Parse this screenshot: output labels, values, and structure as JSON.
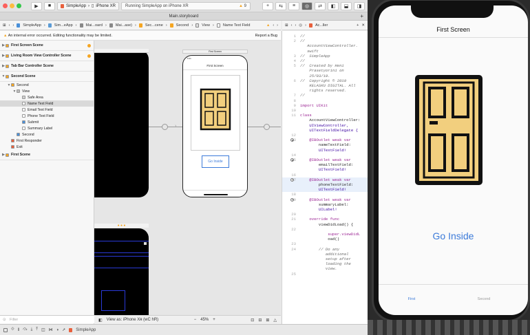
{
  "toolbar": {
    "scheme_app": "SimpleApp",
    "device": "iPhone XR",
    "status": "Running SimpleApp on iPhone XR",
    "warnings": "9"
  },
  "tabbar": {
    "title": "Main.storyboard"
  },
  "jumpbar": {
    "items": [
      "SimpleApp",
      "Sim...eApp",
      "Mai...oard",
      "Mai...ase)",
      "Sec...cene",
      "Second",
      "View",
      "Name Text Field"
    ]
  },
  "jumpbar2": {
    "file": "Ac...ller"
  },
  "errorbar": {
    "message": "An internal error occurred. Editing functionality may be limited.",
    "action": "Report a Bug"
  },
  "outline": {
    "rows": [
      {
        "label": "First Screen Scene",
        "level": 0,
        "tri": "▶",
        "icon": "scene-icon",
        "color": "#f5a623",
        "header": true,
        "warn": true
      },
      {
        "label": "Living Room View Controller Scene",
        "level": 0,
        "tri": "▶",
        "icon": "scene-icon",
        "color": "#f5a623",
        "header": true,
        "warn": true
      },
      {
        "label": "Tab Bar Controller Scene",
        "level": 0,
        "tri": "▶",
        "icon": "scene-icon",
        "color": "#f5a623",
        "header": true,
        "warn": false
      },
      {
        "label": "Second Scene",
        "level": 0,
        "tri": "▼",
        "icon": "scene-icon",
        "color": "#f5a623",
        "header": true,
        "warn": false
      },
      {
        "label": "Second",
        "level": 1,
        "tri": "▼",
        "icon": "view-controller-icon",
        "color": "#f5a623"
      },
      {
        "label": "View",
        "level": 2,
        "tri": "▼",
        "icon": "view-icon",
        "color": "#bbbbbb"
      },
      {
        "label": "Safe Area",
        "level": 3,
        "tri": "",
        "icon": "safe-area-icon",
        "color": "#cfcfcf"
      },
      {
        "label": "Name Text Field",
        "level": 3,
        "tri": "",
        "icon": "textfield-icon",
        "color": "#ffffff",
        "sel": true
      },
      {
        "label": "Email Text Field",
        "level": 3,
        "tri": "",
        "icon": "textfield-icon",
        "color": "#ffffff"
      },
      {
        "label": "Phone Text Field",
        "level": 3,
        "tri": "",
        "icon": "textfield-icon",
        "color": "#ffffff"
      },
      {
        "label": "Submit",
        "level": 3,
        "tri": "",
        "icon": "button-icon",
        "color": "#4a90d9"
      },
      {
        "label": "Summary Label",
        "level": 3,
        "tri": "",
        "icon": "label-icon",
        "color": "#ffffff"
      },
      {
        "label": "Second",
        "level": 2,
        "tri": "",
        "icon": "tabbar-item-icon",
        "color": "#4a90d9"
      },
      {
        "label": "First Responder",
        "level": 1,
        "tri": "",
        "icon": "first-responder-icon",
        "color": "#e8603c"
      },
      {
        "label": "Exit",
        "level": 1,
        "tri": "",
        "icon": "exit-icon",
        "color": "#e8603c"
      },
      {
        "label": "First Scene",
        "level": 0,
        "tri": "▶",
        "icon": "scene-icon",
        "color": "#f5a623",
        "header": true,
        "warn": false
      }
    ],
    "filter": "Filter"
  },
  "canvas": {
    "scene_title": "First Screen",
    "phone_title": "First Screen",
    "button": "Go Inside",
    "zoom": "45%",
    "view_as": "View as: iPhone Xʀ (wC hR)"
  },
  "bottombar": {
    "target": "SimpleApp"
  },
  "code": {
    "lines": [
      {
        "n": "1",
        "t": "//",
        "c": "cmt"
      },
      {
        "n": "2",
        "t": "//",
        "c": "cmt"
      },
      {
        "n": "",
        "t": "   AccountViewController.",
        "c": "cmt"
      },
      {
        "n": "",
        "t": "   swift",
        "c": "cmt"
      },
      {
        "n": "3",
        "t": "//  SimpleApp",
        "c": "cmt"
      },
      {
        "n": "4",
        "t": "//",
        "c": "cmt"
      },
      {
        "n": "5",
        "t": "//  Created by Heni",
        "c": "cmt"
      },
      {
        "n": "",
        "t": "    Prasetyorini on",
        "c": "cmt"
      },
      {
        "n": "",
        "t": "    25/03/19.",
        "c": "cmt"
      },
      {
        "n": "6",
        "t": "//  Copyright © 2019",
        "c": "cmt"
      },
      {
        "n": "",
        "t": "    KELASKU DIGITAL. All",
        "c": "cmt"
      },
      {
        "n": "",
        "t": "    rights reserved.",
        "c": "cmt"
      },
      {
        "n": "7",
        "t": "//",
        "c": "cmt"
      },
      {
        "n": "8",
        "t": "",
        "c": ""
      },
      {
        "n": "9",
        "t": "import UIKit",
        "c": "kw"
      },
      {
        "n": "10",
        "t": "",
        "c": ""
      },
      {
        "n": "11",
        "t": "class",
        "c": "kw"
      },
      {
        "n": "",
        "t": "    AccountViewController:",
        "c": ""
      },
      {
        "n": "",
        "t": "    UIViewController,",
        "c": "ty"
      },
      {
        "n": "",
        "t": "    UITextFieldDelegate {",
        "c": "ty"
      },
      {
        "n": "12",
        "t": "",
        "c": ""
      },
      {
        "n": "13",
        "t": "    @IBOutlet weak var",
        "c": "kw",
        "dot": true
      },
      {
        "n": "",
        "t": "        nameTextField:",
        "c": ""
      },
      {
        "n": "",
        "t": "        UITextField!",
        "c": "ty"
      },
      {
        "n": "14",
        "t": "",
        "c": ""
      },
      {
        "n": "15",
        "t": "    @IBOutlet weak var",
        "c": "kw",
        "dot": true
      },
      {
        "n": "",
        "t": "        emailTextField:",
        "c": ""
      },
      {
        "n": "",
        "t": "        UITextField!",
        "c": "ty"
      },
      {
        "n": "16",
        "t": "",
        "c": ""
      },
      {
        "n": "17",
        "t": "    @IBOutlet weak var",
        "c": "kw",
        "dot": true
      },
      {
        "n": "",
        "t": "        phoneTextField:",
        "c": ""
      },
      {
        "n": "",
        "t": "        UITextField!",
        "c": "ty"
      },
      {
        "n": "18",
        "t": "",
        "c": ""
      },
      {
        "n": "19",
        "t": "    @IBOutlet weak var",
        "c": "kw",
        "dot": true
      },
      {
        "n": "",
        "t": "        summaryLabel:",
        "c": ""
      },
      {
        "n": "",
        "t": "        UILabel!",
        "c": "ty"
      },
      {
        "n": "20",
        "t": "",
        "c": ""
      },
      {
        "n": "21",
        "t": "    override func",
        "c": "kw"
      },
      {
        "n": "",
        "t": "        viewDidLoad() {",
        "c": ""
      },
      {
        "n": "22",
        "t": "",
        "c": ""
      },
      {
        "n": "",
        "t": "            super.viewDidL",
        "c": "kw"
      },
      {
        "n": "",
        "t": "            oad()",
        "c": ""
      },
      {
        "n": "23",
        "t": "",
        "c": ""
      },
      {
        "n": "24",
        "t": "        // Do any",
        "c": "cmt"
      },
      {
        "n": "",
        "t": "           additional",
        "c": "cmt"
      },
      {
        "n": "",
        "t": "           setup after",
        "c": "cmt"
      },
      {
        "n": "",
        "t": "           loading the",
        "c": "cmt"
      },
      {
        "n": "",
        "t": "           view.",
        "c": "cmt"
      },
      {
        "n": "25",
        "t": "",
        "c": ""
      }
    ]
  },
  "simulator": {
    "title": "First Screen",
    "button": "Go Inside",
    "tabs": [
      "First",
      "Second"
    ]
  },
  "colors": {
    "accent": "#3b7ad9",
    "door_fill": "#f2cf7e",
    "door_outline": "#111111",
    "warning": "#f5a623"
  }
}
